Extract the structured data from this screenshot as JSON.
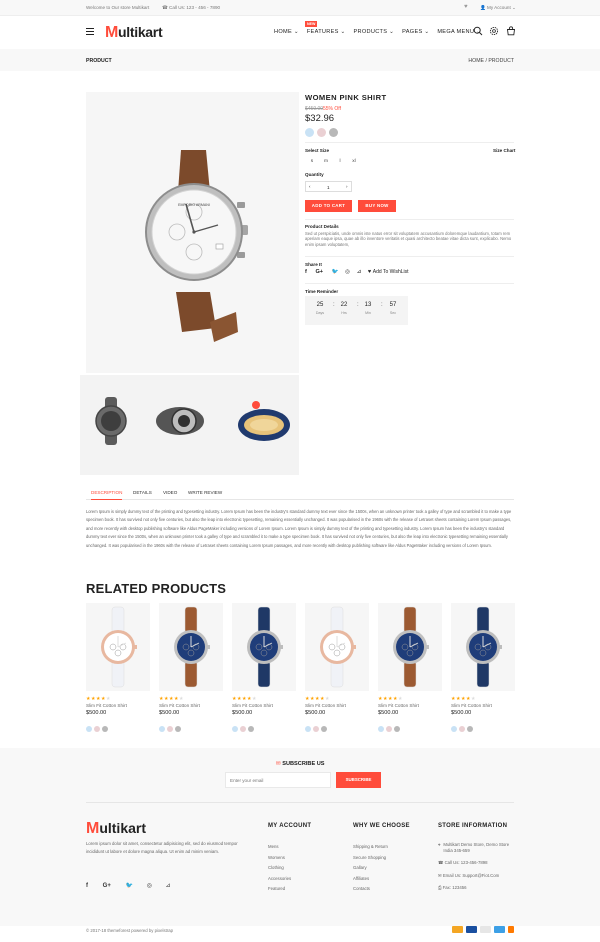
{
  "topbar": {
    "welcome": "Welcome to Our store Multikart",
    "call": "Call Us: 123 - 456 - 7890",
    "account": "My Account"
  },
  "header": {
    "logo_m": "M",
    "logo_rest": "ultikart",
    "nav": [
      "HOME ⌄",
      "FEATURES ⌄",
      "PRODUCTS ⌄",
      "PAGES ⌄",
      "MEGA MENU ⌄"
    ],
    "new_badge": "NEW"
  },
  "breadcrumb": {
    "title": "PRODUCT",
    "home": "HOME",
    "separator": "/",
    "current": "PRODUCT"
  },
  "product": {
    "title": "WOMEN PINK SHIRT",
    "old_price": "$459.00",
    "off": "55% Off",
    "price": "$32.96",
    "swatch_colors": [
      "#c9e2f5",
      "#ead0d3",
      "#b8b8b8"
    ],
    "select_size_label": "Select Size",
    "size_chart_label": "Size Chart",
    "sizes": [
      "s",
      "m",
      "l",
      "xl"
    ],
    "quantity_label": "Quantity",
    "quantity": "1",
    "add_to_cart": "ADD TO CART",
    "buy_now": "BUY NOW",
    "details_label": "Product Details",
    "details_text": "Sed ut perspiciatis, unde omnis iste natus error sit voluptatem accusantium doloremque laudantium, totam rem aperiam eaque ipsa, quae ab illo inventore veritatis et quasi architecto beatae vitae dicta sunt, explicabo. Nemo enim ipsam voluptatem,",
    "share_label": "Share It",
    "wishlist": "Add To WishList",
    "time_label": "Time Reminder",
    "timer": [
      {
        "value": "25",
        "unit": "Days"
      },
      {
        "value": "22",
        "unit": "Hrs"
      },
      {
        "value": "13",
        "unit": "Min"
      },
      {
        "value": "57",
        "unit": "Sec"
      }
    ]
  },
  "tabs": [
    "DESCRIPTION",
    "DETAILS",
    "VIDEO",
    "WRITE REVIEW"
  ],
  "description": "Lorem Ipsum is simply dummy text of the printing and typesetting industry. Lorem Ipsum has been the industry's standard dummy text ever since the 1500s, when an unknown printer took a galley of type and scrambled it to make a type specimen book. It has survived not only five centuries, but also the leap into electronic typesetting, remaining essentially unchanged. It was popularised in the 1960s with the release of Letraset sheets containing Lorem Ipsum passages, and more recently with desktop publishing software like Aldus PageMaker including versions of Lorem Ipsum. Lorem Ipsum is simply dummy text of the printing and typesetting industry. Lorem Ipsum has been the industry's standard dummy text ever since the 1500s, when an unknown printer took a galley of type and scrambled it to make a type specimen book. It has survived not only five centuries, but also the leap into electronic typesetting remaining essentially unchanged. It was popularised in the 1960s with the release of Letraset sheets containing Lorem Ipsum passages, and more recently with desktop publishing software like Aldus PageMaker including versions of Lorem Ipsum.",
  "related": {
    "title": "RELATED PRODUCTS",
    "items": [
      {
        "name": "Slim Fit Cotton Shirt",
        "price": "$500.00",
        "strap": "#f0f2f7",
        "dial": "#ffffff",
        "case": "#e8b8a0"
      },
      {
        "name": "Slim Fit Cotton Shirt",
        "price": "$500.00",
        "strap": "#9c5a32",
        "dial": "#1f3d7a",
        "case": "#c0c0c0"
      },
      {
        "name": "Slim Fit Cotton Shirt",
        "price": "$500.00",
        "strap": "#1f3866",
        "dial": "#1f3d7a",
        "case": "#bdbdbd"
      },
      {
        "name": "Slim Fit Cotton Shirt",
        "price": "$500.00",
        "strap": "#f0f2f7",
        "dial": "#ffffff",
        "case": "#e8b8a0"
      },
      {
        "name": "Slim Fit Cotton Shirt",
        "price": "$500.00",
        "strap": "#9c5a32",
        "dial": "#1f3d7a",
        "case": "#c0c0c0"
      },
      {
        "name": "Slim Fit Cotton Shirt",
        "price": "$500.00",
        "strap": "#1f3866",
        "dial": "#1f3d7a",
        "case": "#bdbdbd"
      }
    ],
    "star_color": "#ffa200"
  },
  "subscribe": {
    "title": "SUBSCRIBE US",
    "placeholder": "Enter your email",
    "button": "SUBSCRIBE"
  },
  "footer": {
    "about": "Lorem ipsum dolor sit amet, consectetur adipisicing elit, sed do eiusmod tempor incididunt ut labore et dolore magna aliqua. Ut enim ad minim veniam.",
    "my_account_title": "MY ACCOUNT",
    "my_account": [
      "Mens",
      "Womens",
      "Clothing",
      "Accessories",
      "Featured"
    ],
    "why_title": "WHY WE CHOOSE",
    "why": [
      "Shipping & Return",
      "Secure Shopping",
      "Gallary",
      "Affiliates",
      "Contacts"
    ],
    "store_title": "STORE INFORMATION",
    "store_address": "Multikart Demo Store, Demo Store India 345-659",
    "store_call": "Call Us: 123-456-7898",
    "store_email": "Email Us: Support@Fiot.Com",
    "store_fax": "Fax: 123456",
    "copyright": "© 2017-18 themeforest powered by pixelstrap",
    "accent": "#ff4c3b"
  }
}
